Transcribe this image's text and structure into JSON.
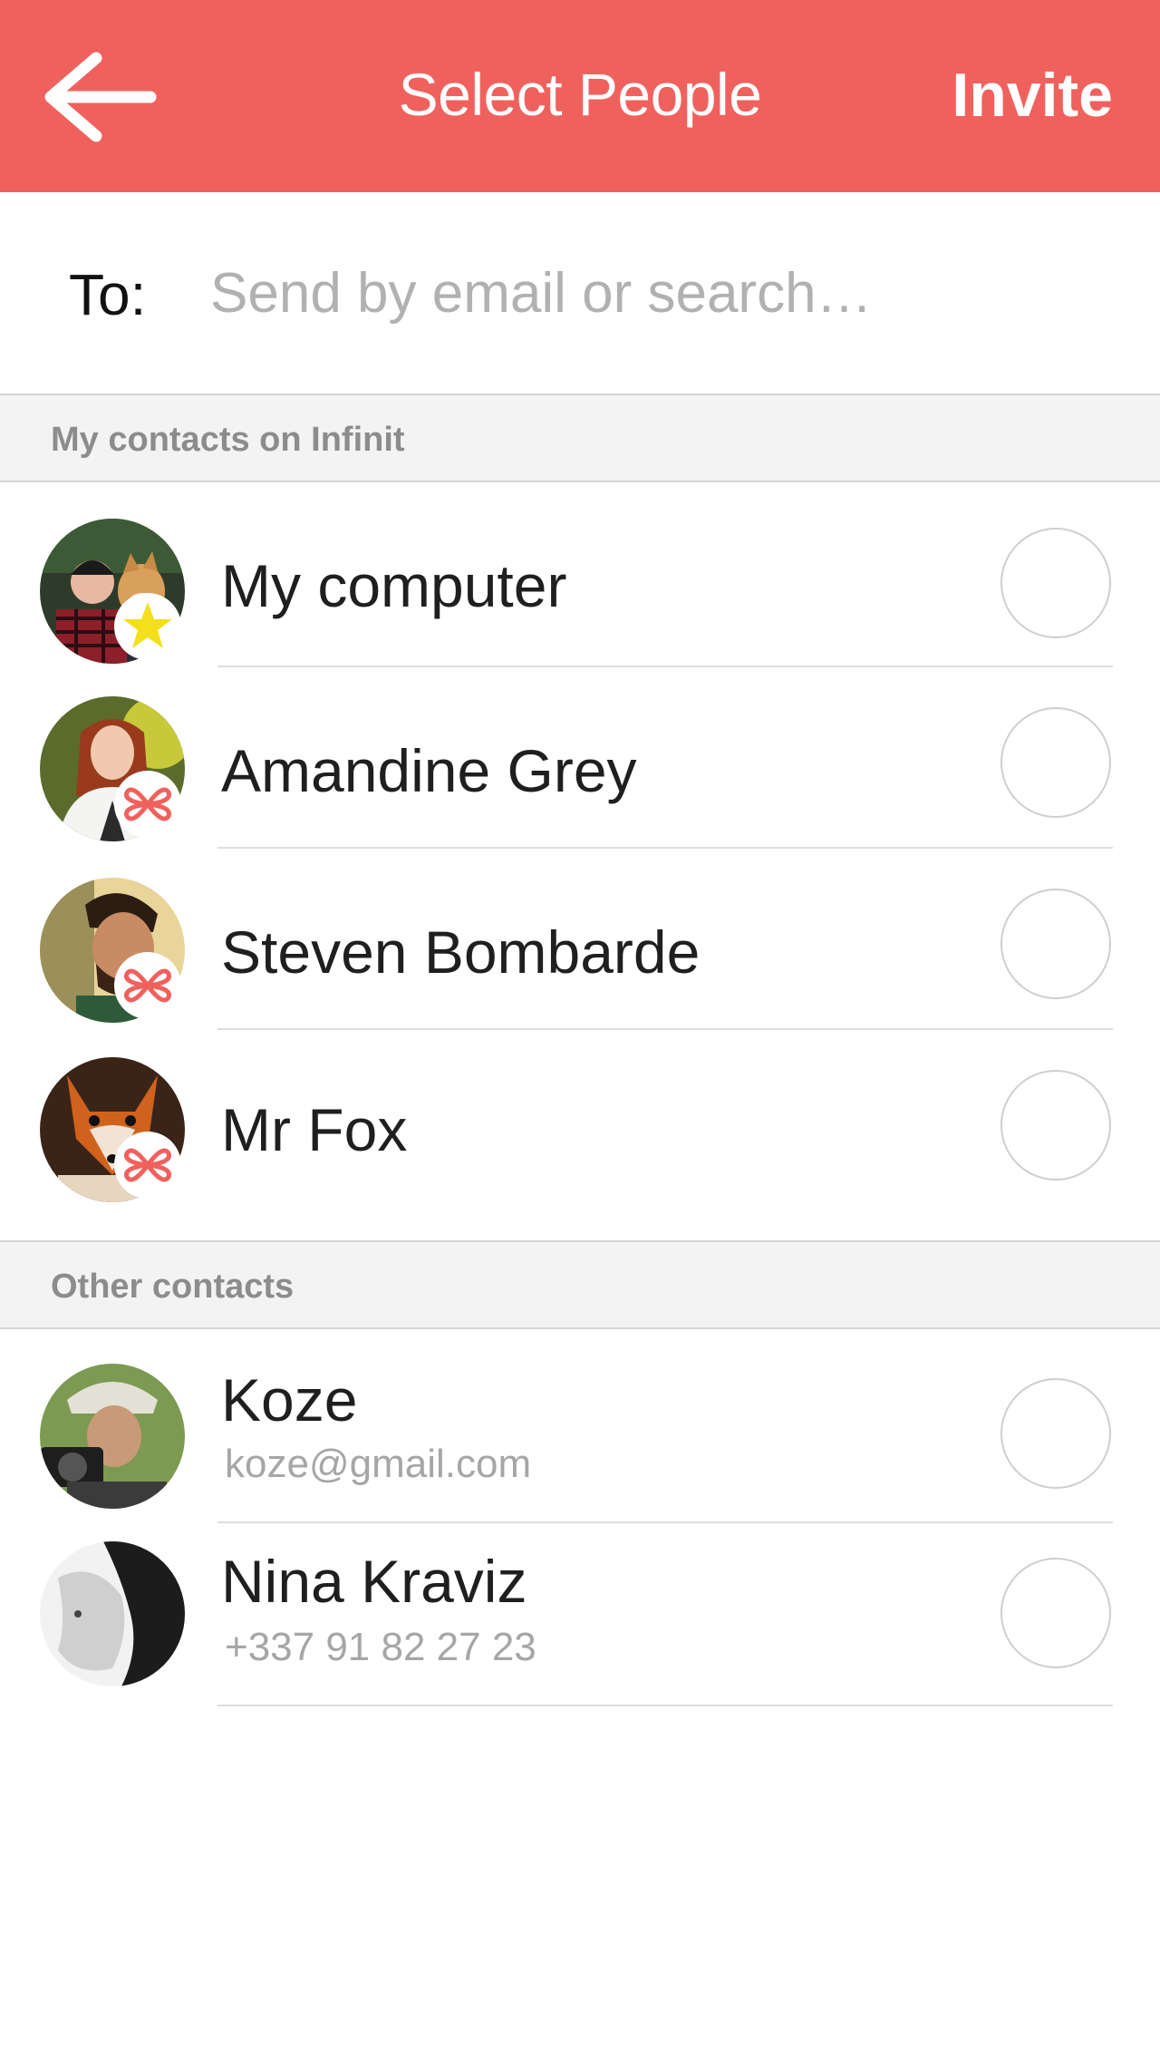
{
  "header": {
    "title": "Select People",
    "invite_label": "Invite",
    "background_color": "#f0615e",
    "back_icon": "arrow-left-icon"
  },
  "recipient": {
    "label": "To:",
    "placeholder": "Send by email or search…",
    "value": ""
  },
  "sections": {
    "infinit_title": "My contacts on Infinit",
    "other_title": "Other contacts"
  },
  "infinit_contacts": [
    {
      "name": "My computer",
      "badge": "star-icon",
      "selected": false
    },
    {
      "name": "Amandine Grey",
      "badge": "infinit-logo-icon",
      "selected": false
    },
    {
      "name": "Steven Bombarde",
      "badge": "infinit-logo-icon",
      "selected": false
    },
    {
      "name": "Mr Fox",
      "badge": "infinit-logo-icon",
      "selected": false
    }
  ],
  "other_contacts": [
    {
      "name": "Koze",
      "detail": "koze@gmail.com",
      "selected": false
    },
    {
      "name": "Nina Kraviz",
      "detail": "+337 91 82 27 23",
      "selected": false
    }
  ],
  "colors": {
    "accent": "#f0615e",
    "star": "#f4e01a",
    "section_bg": "#f3f3f3",
    "section_text": "#8c8c8c"
  }
}
